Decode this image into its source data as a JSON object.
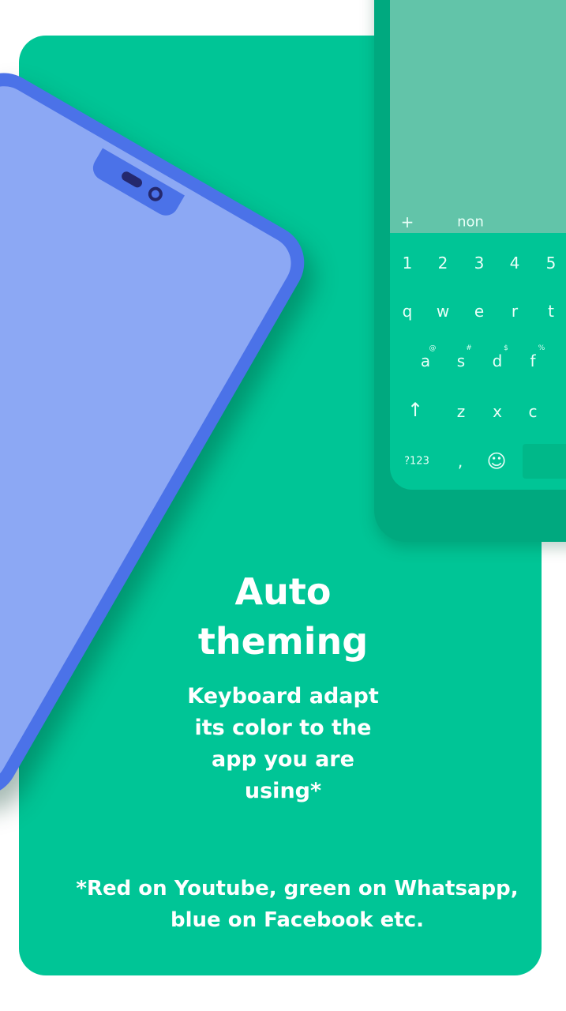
{
  "headline": {
    "line1": "Auto",
    "line2": "theming"
  },
  "subtitle": {
    "lines": [
      "Keyboard adapt",
      "its color to the",
      "app you are",
      "using*"
    ]
  },
  "footnote": {
    "line1": "*Red on Youtube, green on Whatsapp,",
    "line2": "blue on Facebook etc."
  },
  "keyboard": {
    "suggestion": "non",
    "plus_icon": "+",
    "numbers": [
      "1",
      "2",
      "3",
      "4",
      "5"
    ],
    "row1": [
      "q",
      "w",
      "e",
      "r",
      "t"
    ],
    "row2": [
      "a",
      "s",
      "d",
      "f"
    ],
    "row2_hints": [
      "@",
      "#",
      "$",
      "%"
    ],
    "row3": [
      "z",
      "x",
      "c"
    ],
    "symbols_key": "?123",
    "comma_key": ",",
    "shift_icon": "↑",
    "emoji_icon": "☺"
  },
  "colors": {
    "card": "#00c596",
    "left_phone": "#4b72e8",
    "keyboard": "#00c596"
  }
}
